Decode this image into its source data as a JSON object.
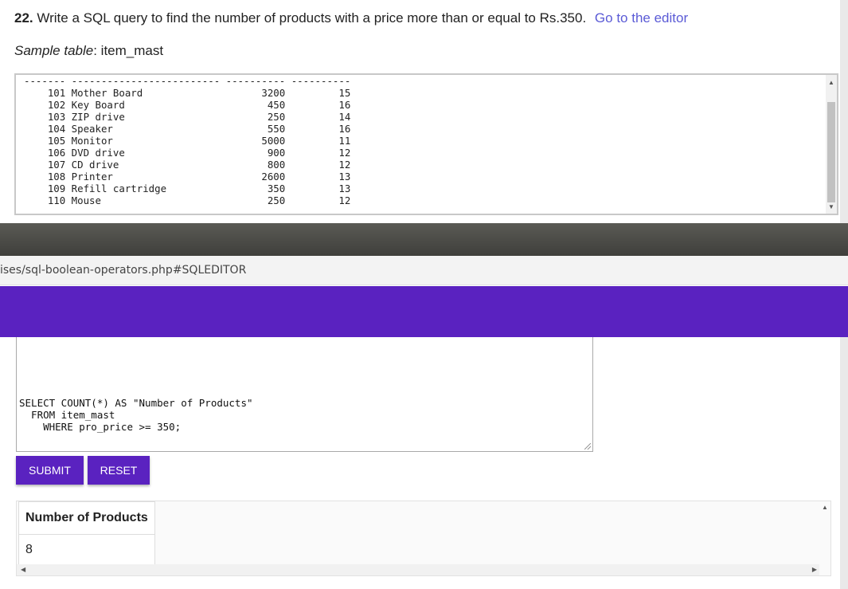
{
  "exercise": {
    "number": "22.",
    "question": "Write a SQL query to find the number of products with a price more than or equal to Rs.350.",
    "editor_link": "Go to the editor",
    "sample_label": "Sample table",
    "sample_table_name": ": item_mast",
    "table_text": "------- ------------------------- ---------- ----------\n    101 Mother Board                    3200         15\n    102 Key Board                        450         16\n    103 ZIP drive                        250         14\n    104 Speaker                          550         16\n    105 Monitor                         5000         11\n    106 DVD drive                        900         12\n    107 CD drive                         800         12\n    108 Printer                         2600         13\n    109 Refill cartridge                 350         13\n    110 Mouse                            250         12"
  },
  "browser": {
    "url_fragment": "ises/sql-boolean-operators.php#SQLEDITOR"
  },
  "editor": {
    "sql": "SELECT COUNT(*) AS \"Number of Products\"\n  FROM item_mast\n    WHERE pro_price >= 350;",
    "submit_label": "SUBMIT",
    "reset_label": "RESET"
  },
  "result": {
    "column_header": "Number of Products",
    "value": "8"
  },
  "colors": {
    "accent": "#5a22c0",
    "link": "#5b5bd6",
    "dark_bar": "#4a4a46"
  }
}
